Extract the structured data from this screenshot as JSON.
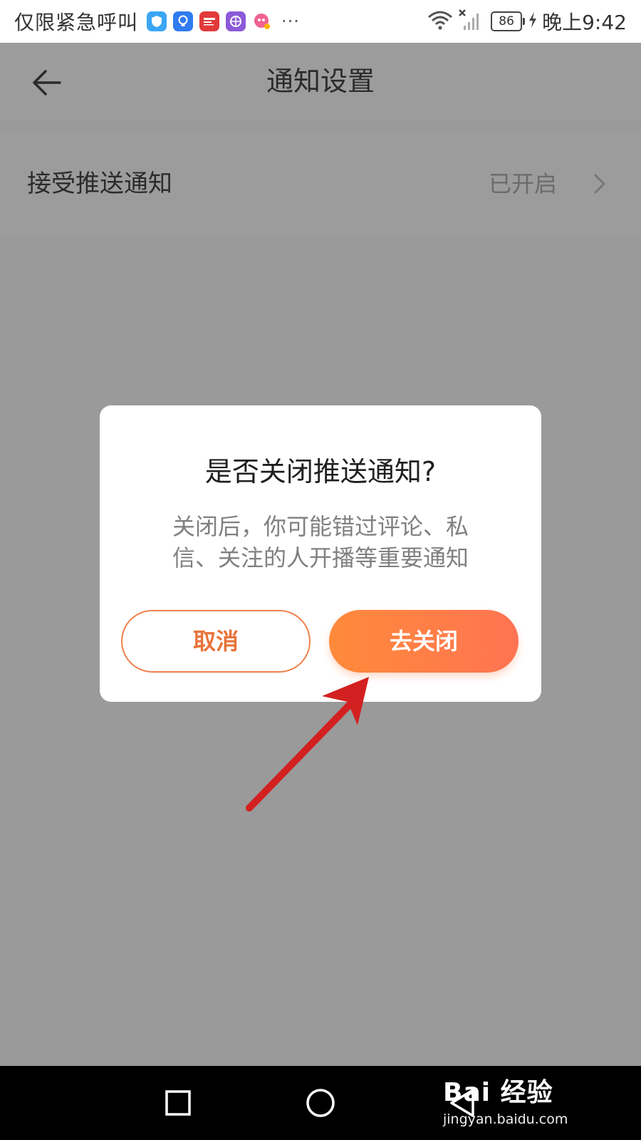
{
  "status_bar": {
    "carrier": "仅限紧急呼叫",
    "notification_icons": [
      {
        "name": "shield-app-icon",
        "color": "#3aa6f5",
        "glyph": "◆"
      },
      {
        "name": "bulb-app-icon",
        "color": "#2f7bf0",
        "glyph": "✱"
      },
      {
        "name": "news-app-icon",
        "color": "#e23a3a",
        "glyph": "齐"
      },
      {
        "name": "browser-app-icon",
        "color": "#8c5ad8",
        "glyph": "●"
      },
      {
        "name": "chat-app-icon",
        "color": "#f06292",
        "glyph": "✿"
      }
    ],
    "more": "···",
    "battery": "86",
    "time": "晚上9:42"
  },
  "header": {
    "title": "通知设置"
  },
  "settings": {
    "push": {
      "label": "接受推送通知",
      "value": "已开启"
    }
  },
  "dialog": {
    "title": "是否关闭推送通知?",
    "message_line1": "关闭后，你可能错过评论、私",
    "message_line2": "信、关注的人开播等重要通知",
    "cancel_label": "取消",
    "confirm_label": "去关闭"
  },
  "watermark": {
    "logo": "Bai 经验",
    "url": "jingyan.baidu.com"
  },
  "colors": {
    "accent": "#ff7a45",
    "overlay": "#9a9a9a",
    "annotation": "#d32020"
  }
}
